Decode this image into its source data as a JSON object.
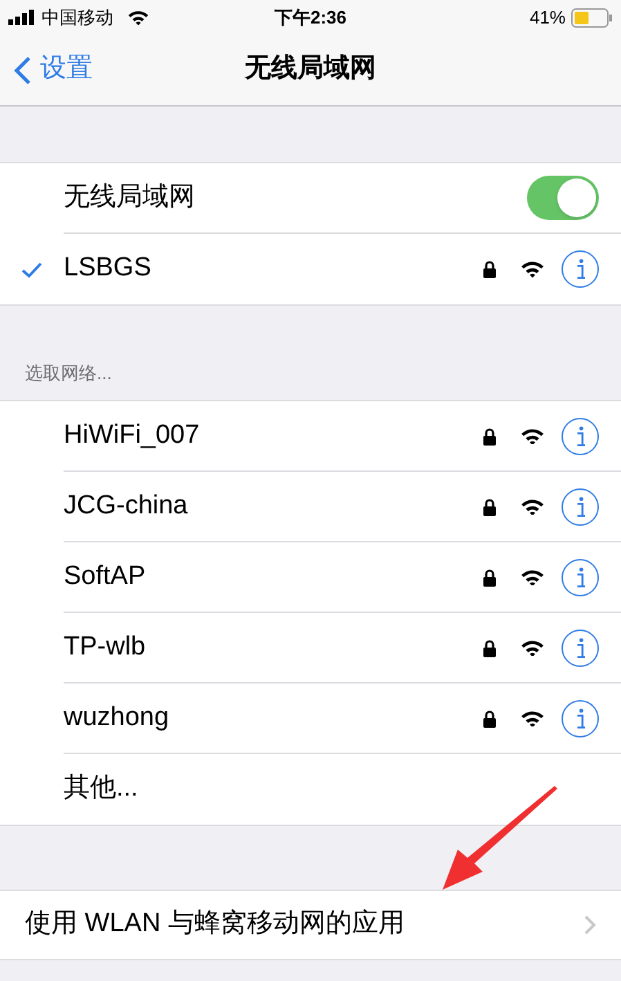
{
  "status_bar": {
    "carrier": "中国移动",
    "time": "下午2:36",
    "battery": "41%"
  },
  "nav": {
    "back": "设置",
    "title": "无线局域网"
  },
  "wifi_toggle": {
    "label": "无线局域网",
    "on": true
  },
  "current_network": {
    "name": "LSBGS",
    "selected": true,
    "locked": true
  },
  "section_header": "选取网络...",
  "networks": [
    {
      "name": "HiWiFi_007",
      "locked": true
    },
    {
      "name": "JCG-china",
      "locked": true
    },
    {
      "name": "SoftAP",
      "locked": true
    },
    {
      "name": "TP-wlb",
      "locked": true
    },
    {
      "name": "wuzhong",
      "locked": true
    }
  ],
  "other": "其他...",
  "apps_row": "使用 WLAN 与蜂窝移动网的应用"
}
